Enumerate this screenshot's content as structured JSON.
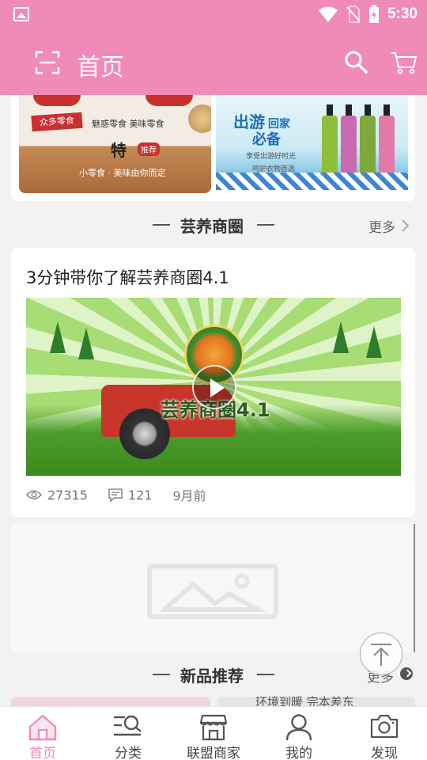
{
  "status_bar": {
    "time": "5:30"
  },
  "app_bar": {
    "title": "首页"
  },
  "banners": {
    "left": {
      "logo": "众多零食",
      "line1": "魅惑零食 美味零食",
      "special": "特",
      "tag": "推荐",
      "subtitle": "小零食 · 美味由你而定"
    },
    "right": {
      "title1": "出游",
      "title2": "回家",
      "title3": "必备",
      "subtitle": "享受出游好时光",
      "small": "呵护衣物首选"
    }
  },
  "section_yunyang": {
    "title": "芸养商圈",
    "more": "更多"
  },
  "article": {
    "title": "3分钟带你了解芸养商圈4.1",
    "video_caption": "芸养商圈4.1",
    "views": "27315",
    "comments": "121",
    "time": "9月前"
  },
  "section_new": {
    "title": "新品推荐",
    "more": "更多",
    "peek_text": "环境到暖 完本差东"
  },
  "bottom_nav": [
    {
      "label": "首页",
      "icon": "home-icon",
      "active": true
    },
    {
      "label": "分类",
      "icon": "category-search-icon",
      "active": false
    },
    {
      "label": "联盟商家",
      "icon": "store-icon",
      "active": false
    },
    {
      "label": "我的",
      "icon": "user-icon",
      "active": false
    },
    {
      "label": "发现",
      "icon": "camera-icon",
      "active": false
    }
  ],
  "colors": {
    "brand": "#f08ab8",
    "background": "#f2f2f2"
  }
}
